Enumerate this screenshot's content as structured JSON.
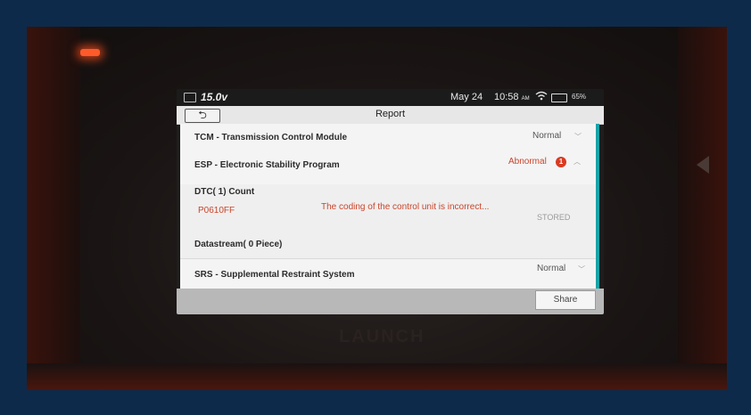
{
  "status_bar": {
    "voltage": "15.0v",
    "date": "May 24",
    "time": "10:58",
    "time_suffix": "AM",
    "battery": "65%",
    "wifi_icon": "wifi-icon",
    "battery_icon": "battery-icon"
  },
  "header": {
    "back_label": "⮌",
    "title": "Report"
  },
  "modules": [
    {
      "label": "TCM - Transmission Control Module",
      "status": "Normal",
      "expanded": false
    },
    {
      "label": "ESP - Electronic Stability Program",
      "status": "Abnormal",
      "badge": "1",
      "expanded": true
    },
    {
      "label": "SRS - Supplemental Restraint System",
      "status": "Normal",
      "expanded": false
    }
  ],
  "esp_detail": {
    "dtc_count": "DTC( 1) Count",
    "dtc_code": "P0610FF",
    "dtc_description": "The coding of the control unit is incorrect...",
    "dtc_state": "STORED",
    "datastream_count": "Datastream( 0 Piece)"
  },
  "footer": {
    "share_label": "Share"
  },
  "device": {
    "brand": "LAUNCH"
  },
  "colors": {
    "abnormal": "#c9452b",
    "accent": "#1aa3a8",
    "badge": "#d93a20"
  }
}
